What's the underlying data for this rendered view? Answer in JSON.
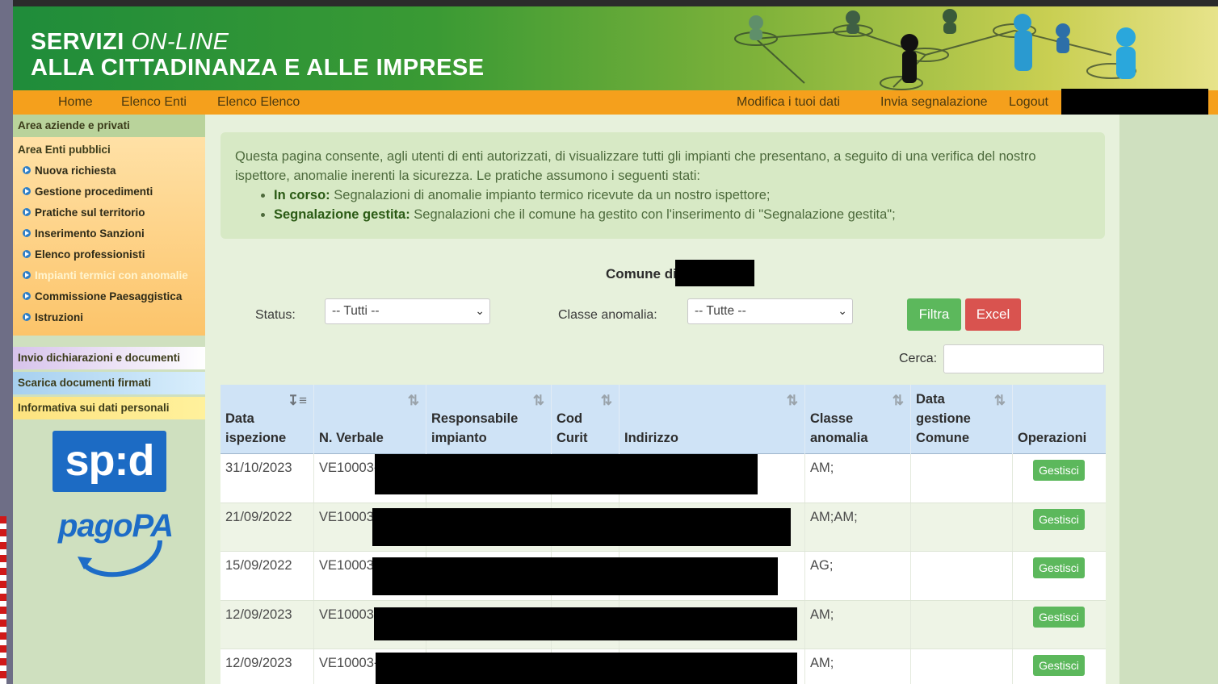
{
  "header": {
    "title_line1_bold": "SERVIZI",
    "title_line1_italic": "ON-LINE",
    "title_line2": "ALLA CITTADINANZA E ALLE IMPRESE"
  },
  "nav": {
    "left": [
      "Home",
      "Elenco Enti",
      "Elenco Elenco"
    ],
    "right": [
      "Modifica i tuoi dati",
      "Invia segnalazione",
      "Logout"
    ]
  },
  "sidebar": {
    "area_aziende": "Area aziende e privati",
    "area_enti": "Area Enti pubblici",
    "items": [
      "Nuova richiesta",
      "Gestione procedimenti",
      "Pratiche sul territorio",
      "Inserimento Sanzioni",
      "Elenco professionisti",
      "Impianti termici con anomalie",
      "Commissione Paesaggistica",
      "Istruzioni"
    ],
    "invio": "Invio dichiarazioni e documenti",
    "scarica": "Scarica documenti firmati",
    "informativa": "Informativa sui dati personali",
    "spid_logo": "sp:d",
    "pagopa_logo": "pagoPA"
  },
  "info": {
    "intro": "Questa pagina consente, agli utenti di enti autorizzati, di visualizzare tutti gli impianti che presentano, a seguito di una verifica del nostro ispettore, anomalie inerenti la sicurezza. Le pratiche assumono i seguenti stati:",
    "bullets": [
      {
        "label": "In corso:",
        "text": " Segnalazioni di anomalie impianto termico ricevute da un nostro ispettore;"
      },
      {
        "label": "Segnalazione gestita:",
        "text": " Segnalazioni che il comune ha gestito con l'inserimento di \"Segnalazione gestita\";"
      }
    ]
  },
  "filters": {
    "comune_label": "Comune di",
    "status_label": "Status:",
    "status_value": "-- Tutti --",
    "classe_label": "Classe anomalia:",
    "classe_value": "-- Tutte --",
    "filtra": "Filtra",
    "excel": "Excel",
    "cerca_label": "Cerca:"
  },
  "table": {
    "headers": [
      [
        "Data",
        "ispezione"
      ],
      [
        "N. Verbale"
      ],
      [
        "Responsabile",
        "impianto"
      ],
      [
        "Cod",
        "Curit"
      ],
      [
        "Indirizzo"
      ],
      [
        "Classe",
        "anomalia"
      ],
      [
        "Data",
        "gestione",
        "Comune"
      ],
      [
        "Operazioni"
      ]
    ],
    "rows": [
      {
        "data": "31/10/2023",
        "verbale": "VE10003-",
        "classe": "AM;",
        "azione": "Gestisci"
      },
      {
        "data": "21/09/2022",
        "verbale": "VE10003",
        "classe": "AM;AM;",
        "azione": "Gestisci"
      },
      {
        "data": "15/09/2022",
        "verbale": "VE10003",
        "classe": "AG;",
        "azione": "Gestisci"
      },
      {
        "data": "12/09/2023",
        "verbale": "VE10003-",
        "classe": "AM;",
        "azione": "Gestisci"
      },
      {
        "data": "12/09/2023",
        "verbale": "VE10003-",
        "classe": "AM;",
        "azione": "Gestisci"
      }
    ]
  },
  "colors": {
    "nav_bg": "#f5a01c",
    "filtra_bg": "#5cb85c",
    "excel_bg": "#d9534f",
    "table_header_bg": "#cfe3f6"
  }
}
